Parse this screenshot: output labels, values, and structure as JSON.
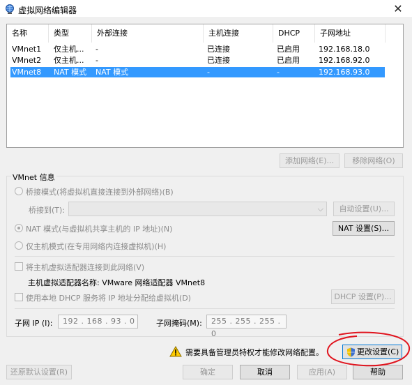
{
  "window": {
    "title": "虚拟网络编辑器",
    "close_glyph": "✕"
  },
  "table": {
    "headers": [
      "名称",
      "类型",
      "外部连接",
      "主机连接",
      "DHCP",
      "子网地址"
    ],
    "rows": [
      {
        "name": "VMnet1",
        "type": "仅主机...",
        "external": "-",
        "host": "已连接",
        "dhcp": "已启用",
        "subnet": "192.168.18.0",
        "selected": false
      },
      {
        "name": "VMnet2",
        "type": "仅主机...",
        "external": "-",
        "host": "已连接",
        "dhcp": "已启用",
        "subnet": "192.168.92.0",
        "selected": false
      },
      {
        "name": "VMnet8",
        "type": "NAT 模式",
        "external": "NAT 模式",
        "host": "-",
        "dhcp": "-",
        "subnet": "192.168.93.0",
        "selected": true
      }
    ]
  },
  "list_buttons": {
    "add": "添加网络(E)...",
    "remove": "移除网络(O)"
  },
  "vmnet_info": {
    "title": "VMnet 信息",
    "bridged": {
      "label": "桥接模式(将虚拟机直接连接到外部网络)(B)",
      "bridge_to_label": "桥接到(T):",
      "auto_button": "自动设置(U)..."
    },
    "nat": {
      "label": "NAT 模式(与虚拟机共享主机的 IP 地址)(N)",
      "settings_button": "NAT 设置(S)...",
      "selected": true
    },
    "host_only": {
      "label": "仅主机模式(在专用网络内连接虚拟机)(H)"
    },
    "connect_adapter": {
      "label": "将主机虚拟适配器连接到此网络(V)",
      "adapter_name": "主机虚拟适配器名称: VMware 网络适配器 VMnet8"
    },
    "dhcp": {
      "label": "使用本地 DHCP 服务将 IP 地址分配给虚拟机(D)",
      "settings_button": "DHCP 设置(P)..."
    },
    "subnet_ip": {
      "label": "子网 IP (I):",
      "value": "192 . 168 . 93 . 0"
    },
    "subnet_mask": {
      "label": "子网掩码(M):",
      "value": "255 . 255 . 255 . 0"
    }
  },
  "admin": {
    "message": "需要具备管理员特权才能修改网络配置。",
    "change_settings": "更改设置(C)"
  },
  "footer": {
    "restore": "还原默认设置(R)",
    "ok": "确定",
    "cancel": "取消",
    "apply": "应用(A)",
    "help": "帮助"
  },
  "colors": {
    "selection": "#3399ff",
    "annotation": "#e0141e"
  }
}
